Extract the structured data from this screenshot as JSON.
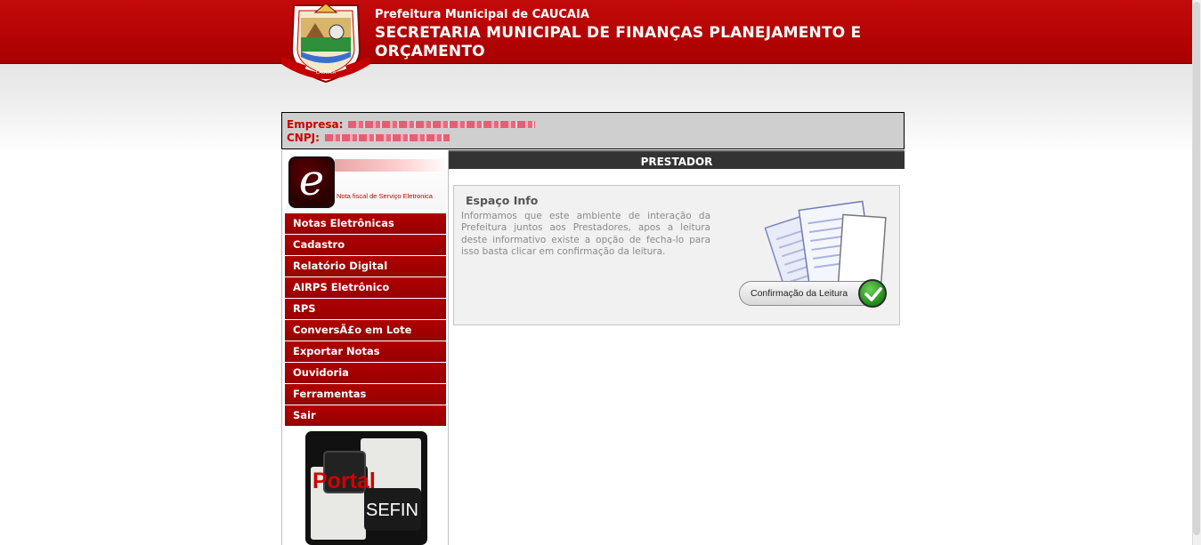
{
  "header": {
    "title_small": "Prefeitura Municipal de CAUCAIA",
    "title_big": "SECRETARIA MUNICIPAL DE FINANÇAS PLANEJAMENTO E ORÇAMENTO",
    "logo_icon": "caucaia-coat-of-arms-icon",
    "logo_text": "CAUCAIA"
  },
  "company": {
    "empresa_label": "Empresa:",
    "cnpj_label": "CNPJ:"
  },
  "sidebar": {
    "logo_caption": "Nota fiscal de Serviço Eletronica",
    "logo_letter": "e",
    "menu": [
      {
        "label": "Notas Eletrônicas"
      },
      {
        "label": "Cadastro"
      },
      {
        "label": "Relatório Digital"
      },
      {
        "label": "AIRPS Eletrônico"
      },
      {
        "label": "RPS"
      },
      {
        "label": "ConversÃ£o em Lote"
      },
      {
        "label": "Exportar Notas"
      },
      {
        "label": "Ouvidoria"
      },
      {
        "label": "Ferramentas"
      },
      {
        "label": "Sair"
      }
    ],
    "portal": {
      "word1": "Portal",
      "word2": "SEFIN"
    }
  },
  "main": {
    "section_title": "PRESTADOR",
    "info": {
      "title": "Espaço Info",
      "text": "Informamos que este ambiente de interação da Prefeitura juntos aos Prestadores, apos a leitura deste informativo existe a opção de fecha-lo para isso basta clicar em confirmação da leitura.",
      "button_label": "Confirmação da Leitura",
      "illustration_icon": "documents-icon",
      "button_icon": "checkmark-icon"
    }
  },
  "colors": {
    "header_red": "#b00000",
    "menu_red": "#a00000",
    "dark_bar": "#333333"
  }
}
